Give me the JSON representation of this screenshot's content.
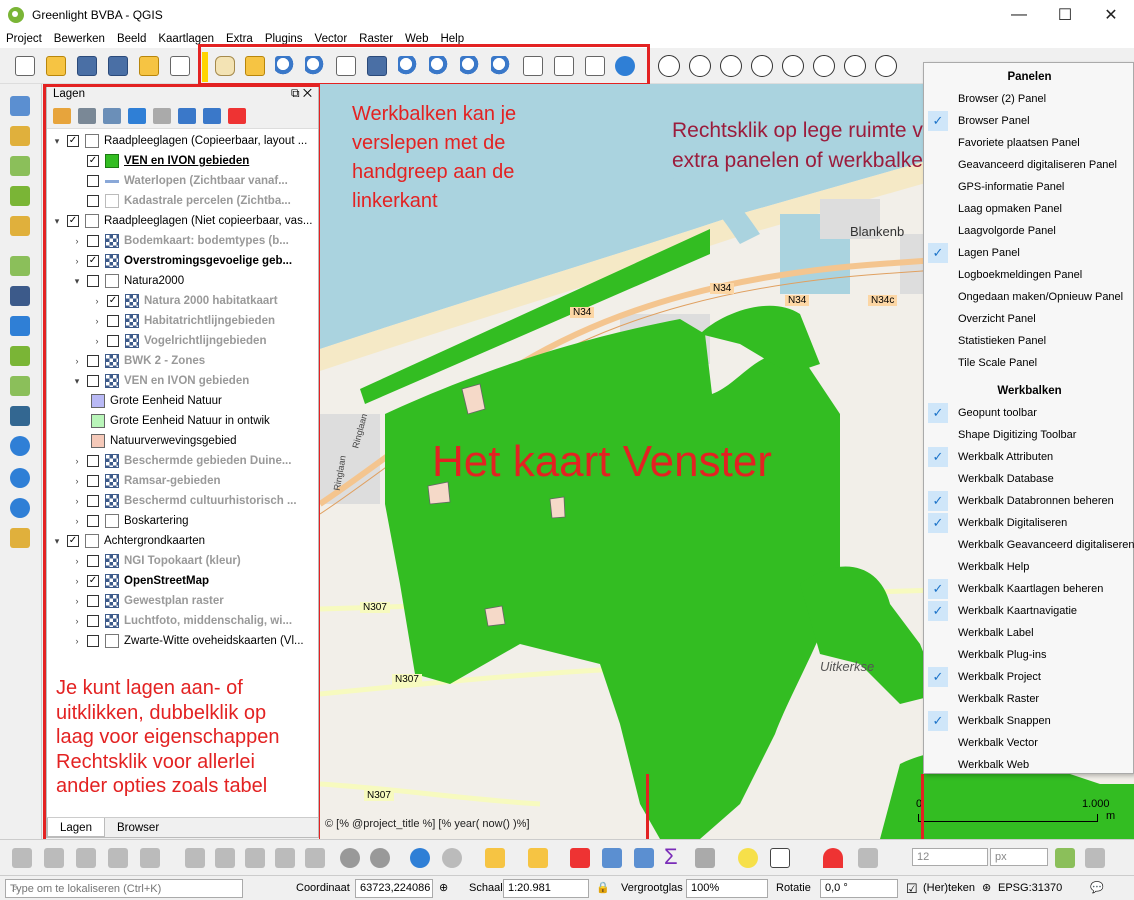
{
  "window": {
    "title": "Greenlight BVBA - QGIS",
    "controls": {
      "minimize": "—",
      "maximize": "☐",
      "close": "✕"
    }
  },
  "menu": [
    "Project",
    "Bewerken",
    "Beeld",
    "Kaartlagen",
    "Extra",
    "Plugins",
    "Vector",
    "Raster",
    "Web",
    "Help"
  ],
  "annotations": {
    "toolbar_note": "Werkbalken kan je\nverslepen met de\nhandgreep aan de\nlinkerkant",
    "context_note": "Rechtsklik op lege ruimte voor\nextra panelen of werkbalken",
    "map_label": "Het kaart Venster",
    "layers_note": "Je kunt lagen aan- of\nuitklikken, dubbelklik op\nlaag voor eigenschappen\nRechtsklik voor allerlei\nander opties zoals tabel"
  },
  "layers_panel": {
    "title": "Lagen",
    "tabs": [
      "Lagen",
      "Browser"
    ],
    "rows": [
      {
        "label": "Raadpleeglagen (Copieerbaar, layout ...",
        "checked": true,
        "expanded": true,
        "kind": "group",
        "style": "normal",
        "indent": 0
      },
      {
        "label": "VEN en IVON gebieden",
        "checked": true,
        "kind": "green",
        "style": "bold-underline",
        "indent": 1
      },
      {
        "label": "Waterlopen (Zichtbaar vanaf...",
        "checked": false,
        "kind": "line",
        "style": "gray",
        "indent": 1
      },
      {
        "label": "Kadastrale percelen (Zichtba...",
        "checked": false,
        "kind": "plain",
        "style": "gray",
        "indent": 1
      },
      {
        "label": "Raadpleeglagen (Niet copieerbaar, vas...",
        "checked": true,
        "expanded": true,
        "kind": "group",
        "style": "normal",
        "indent": 0
      },
      {
        "label": "Bodemkaart: bodemtypes (b...",
        "checked": false,
        "expanded": false,
        "kind": "checker",
        "style": "gray",
        "indent": 1
      },
      {
        "label": "Overstromingsgevoelige geb...",
        "checked": true,
        "expanded": false,
        "kind": "checker",
        "style": "bold",
        "indent": 1
      },
      {
        "label": "Natura2000",
        "checked": false,
        "expanded": true,
        "kind": "group",
        "style": "normal",
        "indent": 1
      },
      {
        "label": "Natura 2000 habitatkaart",
        "checked": true,
        "expanded": false,
        "kind": "checker",
        "style": "gray",
        "indent": 2
      },
      {
        "label": "Habitatrichtlijngebieden",
        "checked": false,
        "expanded": false,
        "kind": "checker",
        "style": "gray",
        "indent": 2
      },
      {
        "label": "Vogelrichtlijngebieden",
        "checked": false,
        "expanded": false,
        "kind": "checker",
        "style": "gray",
        "indent": 2
      },
      {
        "label": "BWK 2 - Zones",
        "checked": false,
        "expanded": false,
        "kind": "checker",
        "style": "gray",
        "indent": 1
      },
      {
        "label": "VEN en IVON gebieden",
        "checked": false,
        "expanded": true,
        "kind": "checker",
        "style": "gray",
        "indent": 1
      },
      {
        "label": "Grote Eenheid Natuur",
        "kind": "legend",
        "color": "#b9b9f5",
        "style": "normal",
        "indent": 2
      },
      {
        "label": "Grote Eenheid Natuur in ontwik",
        "kind": "legend",
        "color": "#b9f5b9",
        "style": "normal",
        "indent": 2
      },
      {
        "label": "Natuurverwevingsgebied",
        "kind": "legend",
        "color": "#f5c9b9",
        "style": "normal",
        "indent": 2
      },
      {
        "label": "Beschermde gebieden Duine...",
        "checked": false,
        "expanded": false,
        "kind": "checker",
        "style": "gray",
        "indent": 1
      },
      {
        "label": "Ramsar-gebieden",
        "checked": false,
        "expanded": false,
        "kind": "checker",
        "style": "gray",
        "indent": 1
      },
      {
        "label": "Beschermd cultuurhistorisch ...",
        "checked": false,
        "expanded": false,
        "kind": "checker",
        "style": "gray",
        "indent": 1
      },
      {
        "label": "Boskartering",
        "checked": false,
        "expanded": false,
        "kind": "group",
        "style": "normal",
        "indent": 1
      },
      {
        "label": "Achtergrondkaarten",
        "checked": true,
        "expanded": true,
        "kind": "group",
        "style": "normal",
        "indent": 0
      },
      {
        "label": "NGI Topokaart (kleur)",
        "checked": false,
        "expanded": false,
        "kind": "checker",
        "style": "gray",
        "indent": 1
      },
      {
        "label": "OpenStreetMap",
        "checked": true,
        "expanded": false,
        "kind": "checker",
        "style": "bold",
        "indent": 1
      },
      {
        "label": "Gewestplan raster",
        "checked": false,
        "expanded": false,
        "kind": "checker",
        "style": "gray",
        "indent": 1
      },
      {
        "label": "Luchtfoto, middenschalig, wi...",
        "checked": false,
        "expanded": false,
        "kind": "checker",
        "style": "gray",
        "indent": 1
      },
      {
        "label": "Zwarte-Witte oveheidskaarten (Vl...",
        "checked": false,
        "expanded": false,
        "kind": "group",
        "style": "normal",
        "indent": 1
      }
    ]
  },
  "context_menu": {
    "panels_header": "Panelen",
    "panels": [
      {
        "label": "Browser (2) Panel",
        "checked": false
      },
      {
        "label": "Browser Panel",
        "checked": true
      },
      {
        "label": "Favoriete plaatsen Panel",
        "checked": false
      },
      {
        "label": "Geavanceerd digitaliseren Panel",
        "checked": false
      },
      {
        "label": "GPS-informatie Panel",
        "checked": false
      },
      {
        "label": "Laag opmaken Panel",
        "checked": false
      },
      {
        "label": "Laagvolgorde Panel",
        "checked": false
      },
      {
        "label": "Lagen Panel",
        "checked": true
      },
      {
        "label": "Logboekmeldingen Panel",
        "checked": false
      },
      {
        "label": "Ongedaan maken/Opnieuw Panel",
        "checked": false
      },
      {
        "label": "Overzicht Panel",
        "checked": false
      },
      {
        "label": "Statistieken Panel",
        "checked": false
      },
      {
        "label": "Tile Scale Panel",
        "checked": false
      }
    ],
    "toolbars_header": "Werkbalken",
    "toolbars": [
      {
        "label": "Geopunt toolbar",
        "checked": true
      },
      {
        "label": "Shape Digitizing Toolbar",
        "checked": false
      },
      {
        "label": "Werkbalk Attributen",
        "checked": true
      },
      {
        "label": "Werkbalk Database",
        "checked": false
      },
      {
        "label": "Werkbalk Databronnen beheren",
        "checked": true
      },
      {
        "label": "Werkbalk Digitaliseren",
        "checked": true
      },
      {
        "label": "Werkbalk Geavanceerd digitaliseren",
        "checked": false
      },
      {
        "label": "Werkbalk Help",
        "checked": false
      },
      {
        "label": "Werkbalk Kaartlagen beheren",
        "checked": true
      },
      {
        "label": "Werkbalk Kaartnavigatie",
        "checked": true
      },
      {
        "label": "Werkbalk Label",
        "checked": false
      },
      {
        "label": "Werkbalk Plug-ins",
        "checked": false
      },
      {
        "label": "Werkbalk Project",
        "checked": true
      },
      {
        "label": "Werkbalk Raster",
        "checked": false
      },
      {
        "label": "Werkbalk Snappen",
        "checked": true
      },
      {
        "label": "Werkbalk Vector",
        "checked": false
      },
      {
        "label": "Werkbalk Web",
        "checked": false
      }
    ]
  },
  "map": {
    "place_labels": [
      "Blankenb",
      "Uitkerkse"
    ],
    "road_labels": [
      "N34",
      "N34",
      "N34c",
      "N34",
      "N307",
      "N307",
      "N307",
      "Ringlaan",
      "Ringlaan"
    ],
    "copyright": "© [% @project_title %] [% year( now() )%]",
    "scalebar": {
      "start": "0",
      "end": "1.000",
      "unit": "m"
    }
  },
  "bottom_toolbar": {
    "spin_value": "12",
    "unit": "px"
  },
  "statusbar": {
    "locate_placeholder": "Type om te lokaliseren (Ctrl+K)",
    "coord_label": "Coordinaat",
    "coord_value": "63723,224086",
    "scale_label": "Schaal",
    "scale_value": "1:20.981",
    "magnifier_label": "Vergrootglas",
    "magnifier_value": "100%",
    "rotation_label": "Rotatie",
    "rotation_value": "0,0 °",
    "render_label": "(Her)teken",
    "crs": "EPSG:31370"
  },
  "colors": {
    "annotation_red": "#e32222",
    "annotation_dark": "#9b1c3c",
    "nature_green": "#33bd22",
    "sea": "#aad3df",
    "check": "#1e74c9"
  }
}
